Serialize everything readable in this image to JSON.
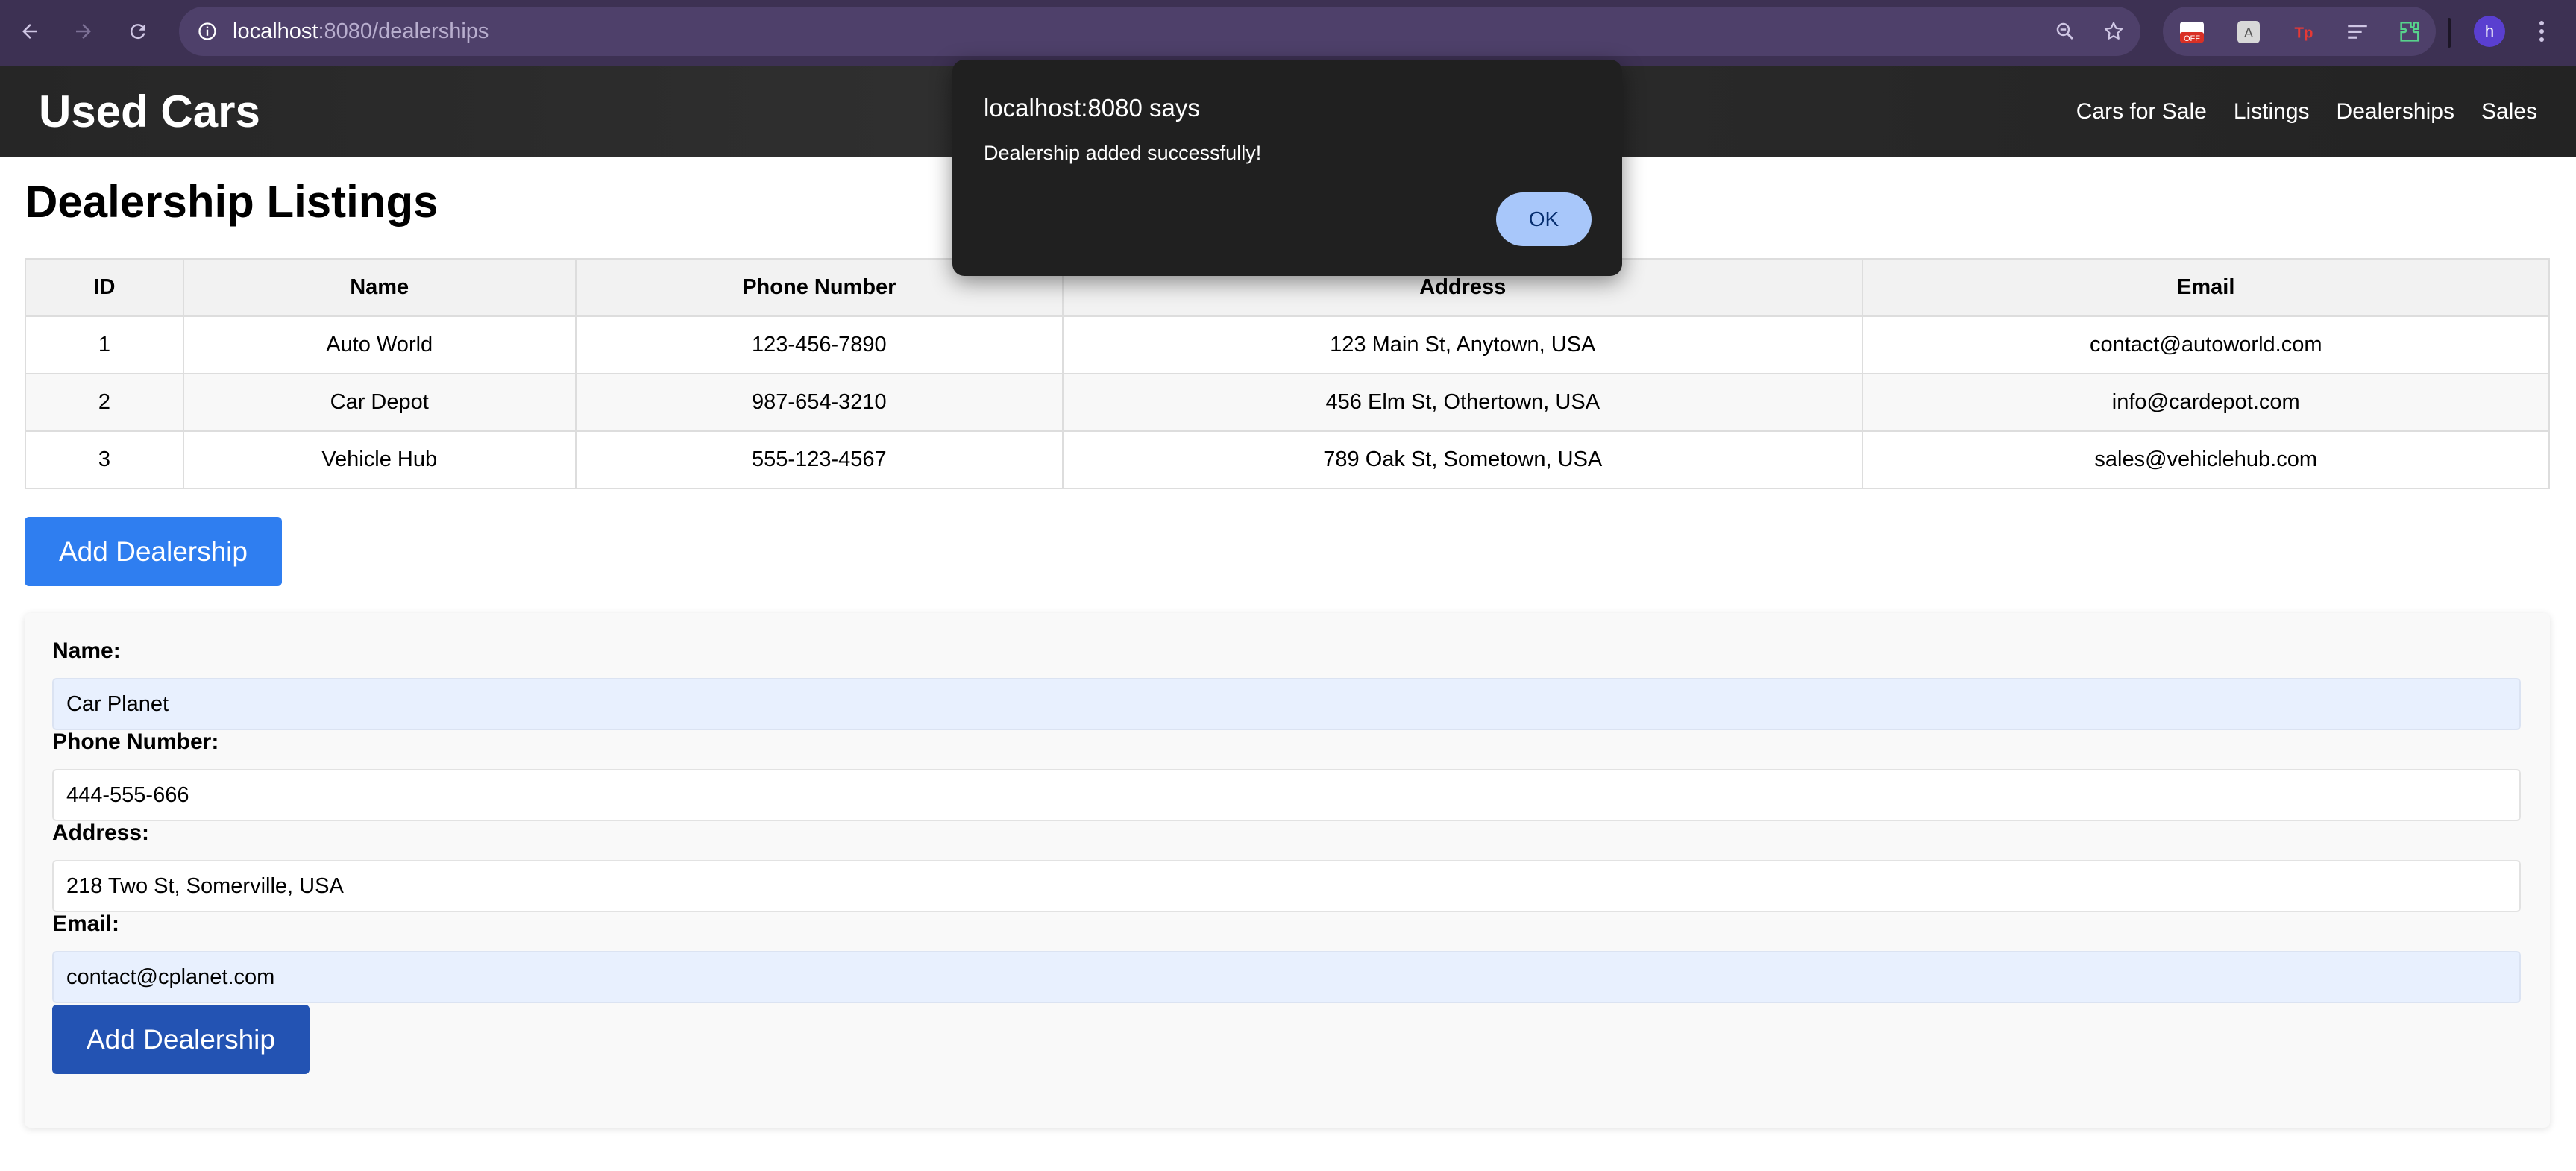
{
  "browser": {
    "url_host": "localhost",
    "url_path": ":8080/dealerships",
    "profile_initial": "h",
    "extension_badge": "OFF",
    "extension_tp": "Tp",
    "extension_letter": "A"
  },
  "header": {
    "brand": "Used Cars",
    "nav": [
      "Cars for Sale",
      "Listings",
      "Dealerships",
      "Sales"
    ]
  },
  "page": {
    "title": "Dealership Listings"
  },
  "table": {
    "columns": [
      "ID",
      "Name",
      "Phone Number",
      "Address",
      "Email"
    ],
    "rows": [
      [
        "1",
        "Auto World",
        "123-456-7890",
        "123 Main St, Anytown, USA",
        "contact@autoworld.com"
      ],
      [
        "2",
        "Car Depot",
        "987-654-3210",
        "456 Elm St, Othertown, USA",
        "info@cardepot.com"
      ],
      [
        "3",
        "Vehicle Hub",
        "555-123-4567",
        "789 Oak St, Sometown, USA",
        "sales@vehiclehub.com"
      ]
    ]
  },
  "toggle_button_label": "Add Dealership",
  "form": {
    "name_label": "Name:",
    "name_value": "Car Planet",
    "phone_label": "Phone Number:",
    "phone_value": "444-555-666",
    "address_label": "Address:",
    "address_value": "218 Two St, Somerville, USA",
    "email_label": "Email:",
    "email_value": "contact@cplanet.com",
    "submit_label": "Add Dealership"
  },
  "alert": {
    "title": "localhost:8080 says",
    "message": "Dealership added successfully!",
    "ok_label": "OK"
  },
  "colors": {
    "browser_frame": "#3d3153",
    "header_bg": "#282828",
    "primary_button": "#2f7ef0",
    "submit_button": "#2353b3",
    "alert_bg": "#202020",
    "alert_ok": "#a8c7fa"
  }
}
